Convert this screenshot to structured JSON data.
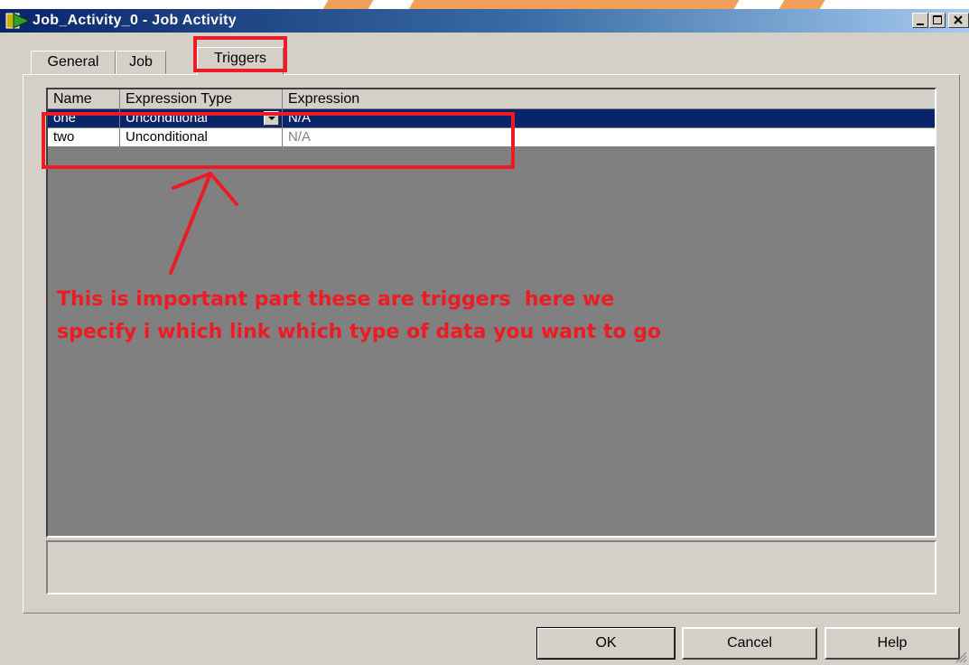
{
  "window": {
    "title": "Job_Activity_0 - Job Activity",
    "icon": "job-activity-icon",
    "controls": [
      "minimize-icon",
      "maximize-icon",
      "close-icon"
    ]
  },
  "tabs": [
    {
      "label": "General",
      "selected": false
    },
    {
      "label": "Job",
      "selected": false
    },
    {
      "label": "Triggers",
      "selected": true
    }
  ],
  "grid": {
    "columns": [
      "Name",
      "Expression Type",
      "Expression"
    ],
    "rows": [
      {
        "name": "one",
        "expression_type": "Unconditional",
        "expression": "N/A",
        "selected": true
      },
      {
        "name": "two",
        "expression_type": "Unconditional",
        "expression": "N/A",
        "selected": false
      }
    ]
  },
  "annotation": {
    "line1": "This is important part these are triggers  here we",
    "line2": "specify i which link which type of data you want to go",
    "color": "#ed1c24"
  },
  "buttons": {
    "ok": "OK",
    "cancel": "Cancel",
    "help": "Help"
  },
  "colors": {
    "title_bar": "#0a246a",
    "selection": "#0a246a",
    "face": "#d4d0c8",
    "grid_background": "#808080"
  }
}
